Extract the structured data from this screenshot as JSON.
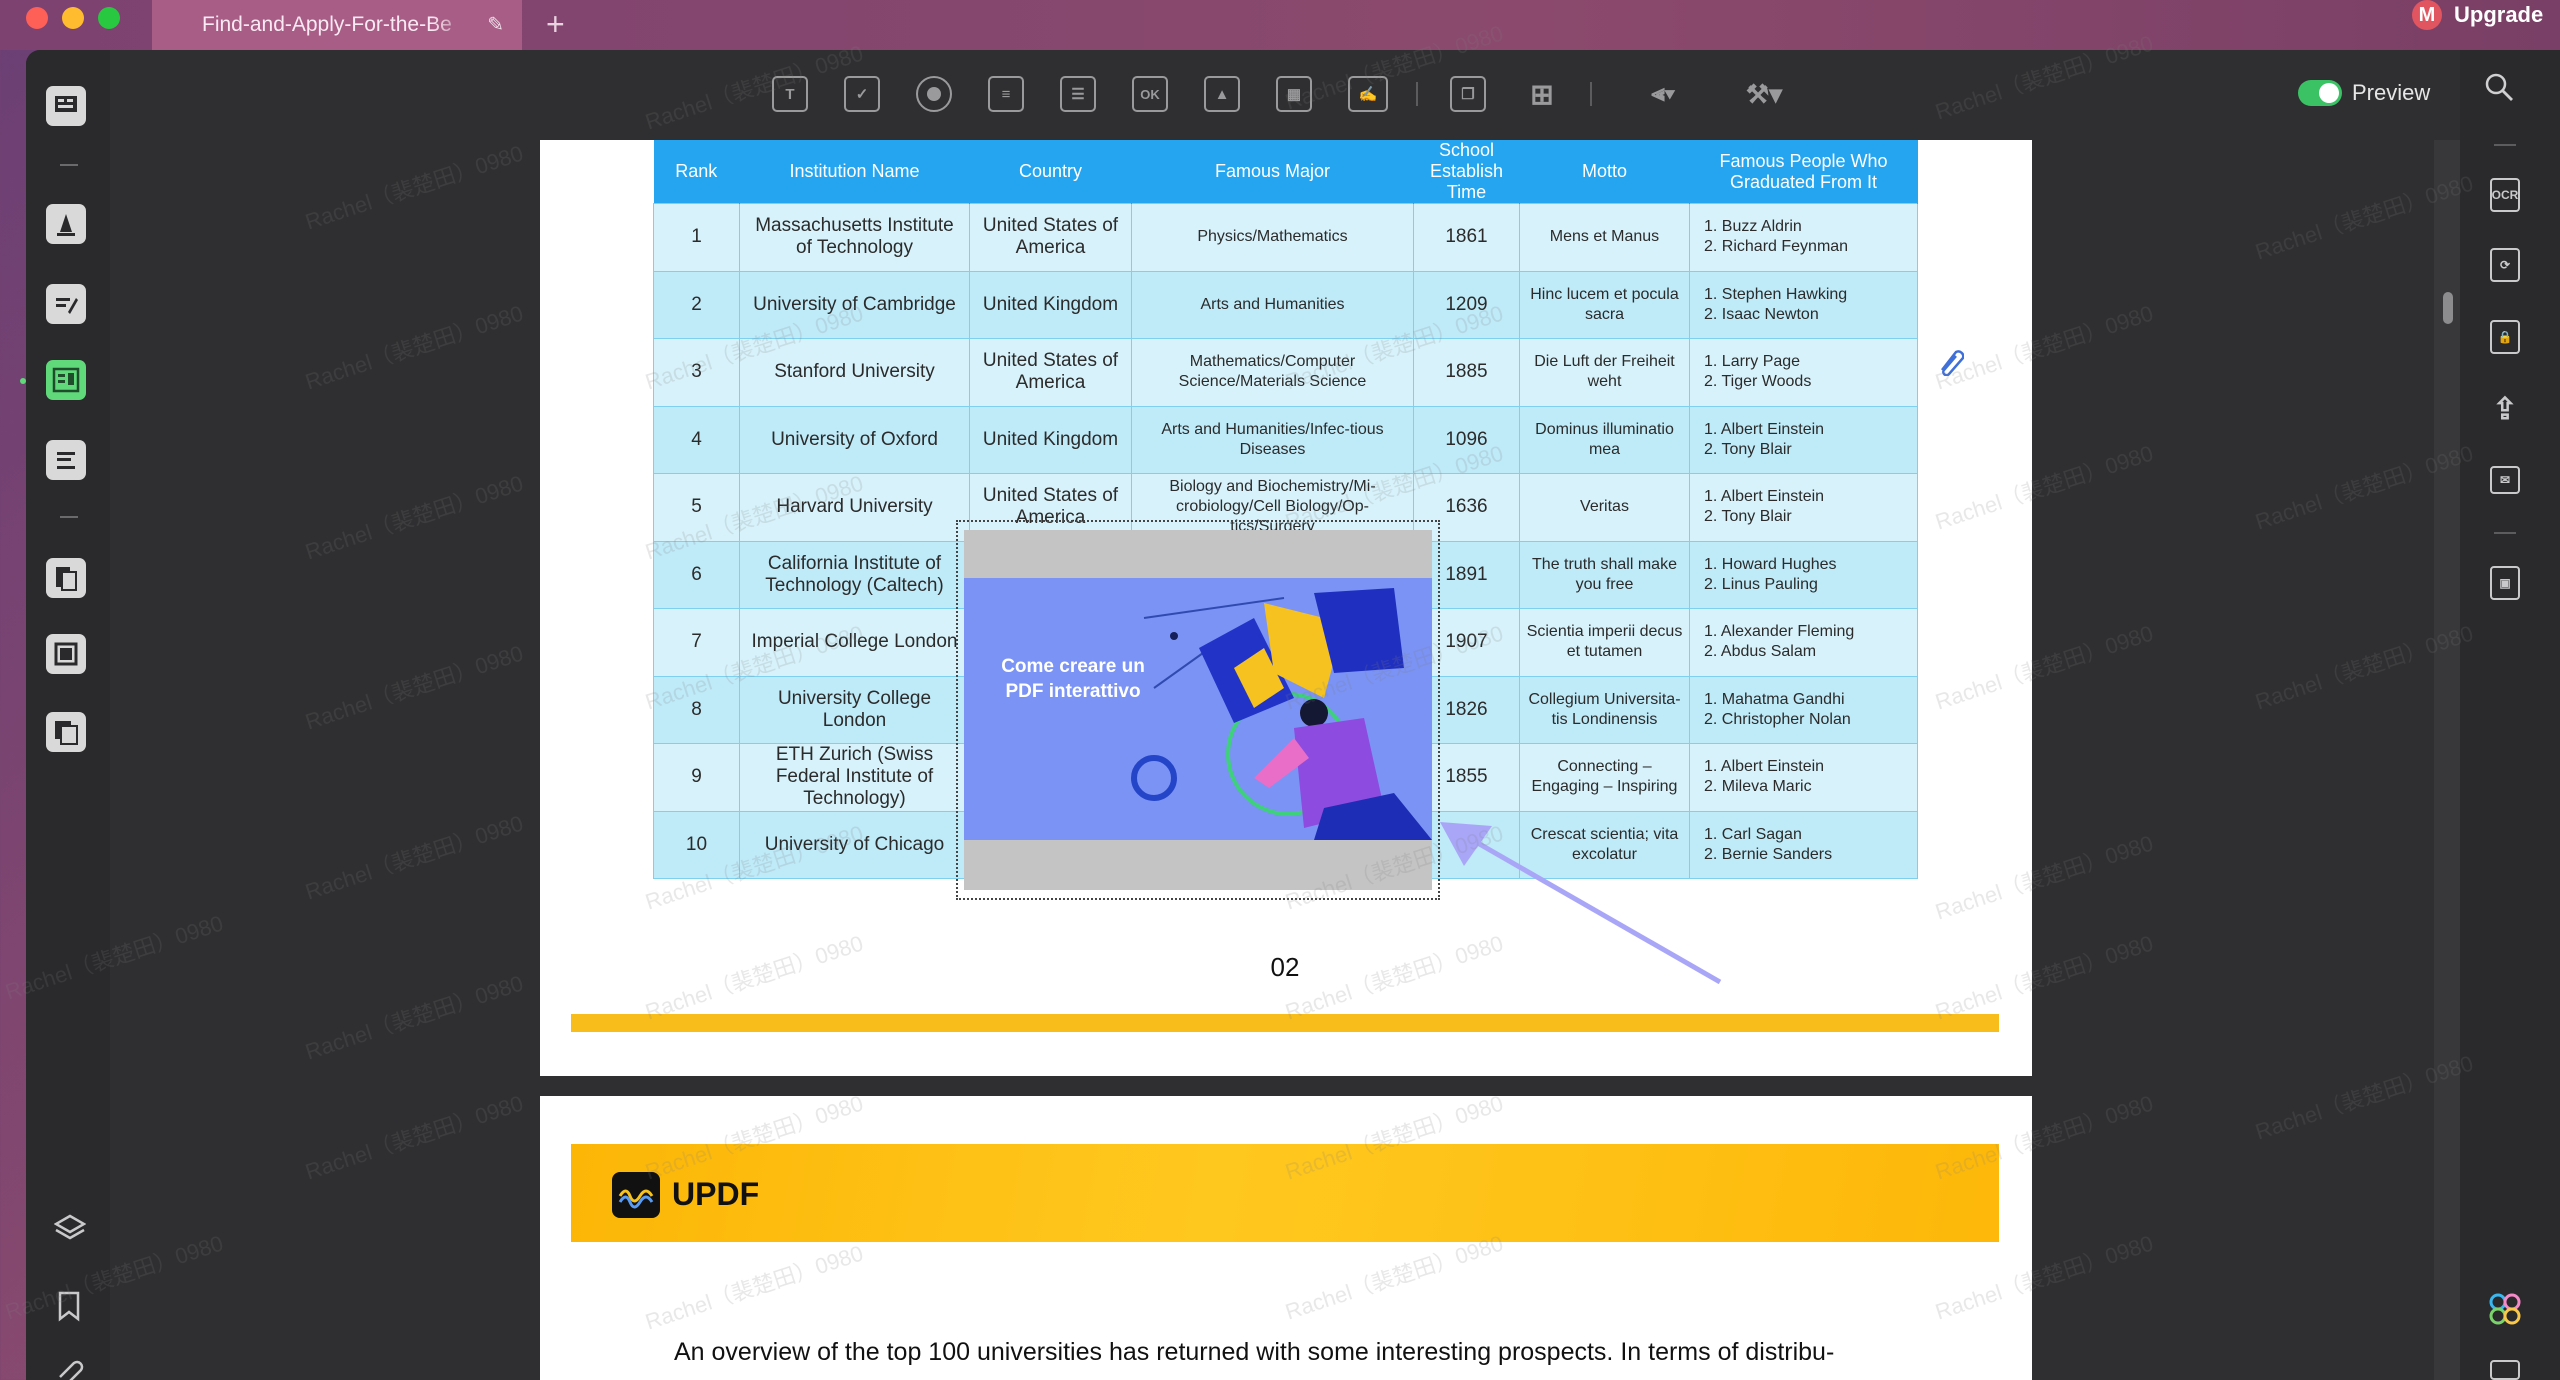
{
  "window": {
    "tab_title": "Find-and-Apply-For-the-Be",
    "new_tab": "+",
    "avatar_letter": "M",
    "upgrade": "Upgrade"
  },
  "toolbar": {
    "tools": [
      "text-field-icon",
      "checkbox-icon",
      "radio-button-icon",
      "dropdown-icon",
      "list-box-icon",
      "button-ok-icon",
      "image-field-icon",
      "date-field-icon",
      "signature-field-icon",
      "form-pages-icon",
      "grid-layout-icon",
      "align-icon",
      "form-tools-icon"
    ],
    "ok_label": "OK",
    "text_label": "T",
    "preview_label": "Preview",
    "preview_on": true
  },
  "left_rail": {
    "items": [
      "reader-icon",
      "comment-icon",
      "edit-icon",
      "form-icon",
      "sign-icon",
      "organize-icon",
      "crop-icon",
      "convert-icon"
    ],
    "active": "form-icon",
    "bottom": [
      "layers-icon",
      "bookmark-icon",
      "attachment-icon"
    ]
  },
  "right_rail": {
    "items": [
      "search-icon",
      "ocr-icon",
      "convert-file-icon",
      "protect-icon",
      "share-icon",
      "email-icon",
      "save-icon",
      "ai-icon"
    ],
    "ocr_label": "OCR"
  },
  "table": {
    "headers": [
      "Rank",
      "Institution Name",
      "Country",
      "Famous Major",
      "School Establish Time",
      "Motto",
      "Famous People Who Graduated From It"
    ],
    "rows": [
      {
        "rank": "1",
        "name": "Massachusetts Institute of Technology",
        "country": "United States of America",
        "major": "Physics/Mathematics",
        "year": "1861",
        "motto": "Mens et Manus",
        "p1": "1. Buzz Aldrin",
        "p2": "2. Richard Feynman"
      },
      {
        "rank": "2",
        "name": "University of Cambridge",
        "country": "United Kingdom",
        "major": "Arts and Humanities",
        "year": "1209",
        "motto": "Hinc lucem et pocula sacra",
        "p1": "1. Stephen Hawking",
        "p2": "2. Isaac Newton"
      },
      {
        "rank": "3",
        "name": "Stanford University",
        "country": "United States of America",
        "major": "Mathematics/Computer Science/Materials Science",
        "year": "1885",
        "motto": "Die Luft der Freiheit weht",
        "p1": "1. Larry Page",
        "p2": "2. Tiger Woods"
      },
      {
        "rank": "4",
        "name": "University of Oxford",
        "country": "United Kingdom",
        "major": "Arts and Humanities/Infec-tious Diseases",
        "year": "1096",
        "motto": "Dominus illuminatio mea",
        "p1": "1. Albert Einstein",
        "p2": "2. Tony Blair"
      },
      {
        "rank": "5",
        "name": "Harvard University",
        "country": "United States of America",
        "major": "Biology and Biochemistry/Mi-crobiology/Cell Biology/Op-tics/Surgery",
        "year": "1636",
        "motto": "Veritas",
        "p1": "1. Albert Einstein",
        "p2": "2. Tony Blair"
      },
      {
        "rank": "6",
        "name": "California Institute of Technology (Caltech)",
        "country": "",
        "major": "",
        "year": "1891",
        "motto": "The truth shall make you free",
        "p1": "1. Howard Hughes",
        "p2": "2. Linus Pauling"
      },
      {
        "rank": "7",
        "name": "Imperial College London",
        "country": "",
        "major": "",
        "year": "1907",
        "motto": "Scientia imperii decus et tutamen",
        "p1": "1. Alexander Fleming",
        "p2": "2. Abdus Salam"
      },
      {
        "rank": "8",
        "name": "University College London",
        "country": "",
        "major": "",
        "year": "1826",
        "motto": "Collegium Universita-tis Londinensis",
        "p1": "1. Mahatma Gandhi",
        "p2": "2. Christopher Nolan"
      },
      {
        "rank": "9",
        "name": "ETH Zurich (Swiss Federal Institute of Technology)",
        "country": "",
        "major": "",
        "year": "1855",
        "motto": "Connecting – Engaging – Inspiring",
        "p1": "1. Albert Einstein",
        "p2": "2. Mileva Maric"
      },
      {
        "rank": "10",
        "name": "University of Chicago",
        "country": "",
        "major": "",
        "year": "",
        "motto": "Crescat scientia; vita excolatur",
        "p1": "1. Carl Sagan",
        "p2": "2. Bernie Sanders"
      }
    ]
  },
  "media": {
    "video_text": "Come creare un PDF interattivo"
  },
  "page": {
    "number": "02",
    "brand": "UPDF",
    "body_text": "An overview of the top 100 universities has returned with some interesting prospects. In terms of distribu-"
  },
  "watermark": "Rachel（裴楚田）0980",
  "colors": {
    "table_header": "#25a5ef",
    "table_row": "#c9eef9",
    "banner": "#fdb809",
    "active": "#5fd97a",
    "arrow": "#a9a6f8"
  }
}
